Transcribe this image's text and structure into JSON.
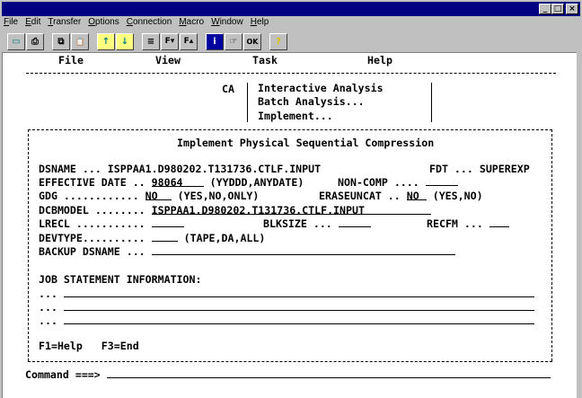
{
  "window": {
    "minimize": "_",
    "maximize": "□",
    "close": "×"
  },
  "menubar": [
    "File",
    "Edit",
    "Transfer",
    "Options",
    "Connection",
    "Macro",
    "Window",
    "Help"
  ],
  "toolbar": [
    "display-icon",
    "print-icon",
    "copy-icon",
    "paste-icon",
    "send-file-icon",
    "receive-file-icon",
    "print-screen-icon",
    "font-down-icon",
    "font-up-icon",
    "info-icon",
    "pointer-icon",
    "ok-icon",
    "help-icon"
  ],
  "toolbar_glyphs": [
    "▭",
    "⎙",
    "⧉",
    "📋",
    "↑",
    "↓",
    "≡",
    "F▾",
    "F▴",
    "i",
    "☞",
    "OK",
    "?"
  ],
  "ispf_menu": [
    "File",
    "View",
    "Task",
    "Help"
  ],
  "ca_label": "CA",
  "task_menu": [
    "Interactive Analysis",
    "Batch Analysis...",
    "Implement..."
  ],
  "dialog": {
    "title": "Implement Physical Sequential Compression",
    "dsname_label": "DSNAME ... ",
    "dsname": "ISPPAA1.D980202.T131736.CTLF.INPUT",
    "fdt_label": "FDT ... ",
    "fdt": "SUPEREXP",
    "effdate_label": "EFFECTIVE DATE .. ",
    "effdate": "98064",
    "effdate_hint": "(YYDDD,ANYDATE)",
    "noncomp_label": "NON-COMP .... ",
    "noncomp": "",
    "gdg_label": "GDG ............ ",
    "gdg": "NO",
    "gdg_hint": "(YES,NO,ONLY)",
    "erase_label": "ERASEUNCAT .. ",
    "erase": "NO",
    "erase_hint": "(YES,NO)",
    "dcb_label": "DCBMODEL ........ ",
    "dcb": "ISPPAA1.D980202.T131736.CTLF.INPUT",
    "lrecl_label": "LRECL ........... ",
    "lrecl": "",
    "blksize_label": "BLKSIZE ... ",
    "blksize": "",
    "recfm_label": "RECFM ... ",
    "recfm": "",
    "devtype_label": "DEVTYPE.......... ",
    "devtype": "",
    "devtype_hint": "(TAPE,DA,ALL)",
    "backup_label": "BACKUP DSNAME ... ",
    "backup": "",
    "job_label": "JOB STATEMENT INFORMATION:",
    "job_prefix": "...",
    "job_lines": [
      "",
      "",
      ""
    ],
    "keys": "F1=Help   F3=End"
  },
  "command_label": "Command ===>",
  "command": ""
}
